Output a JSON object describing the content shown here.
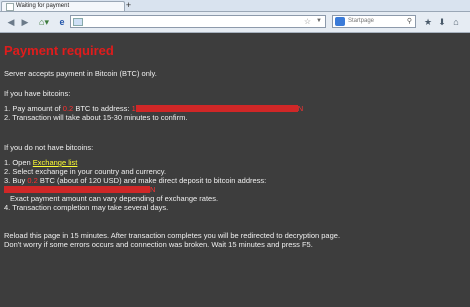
{
  "browser": {
    "tab_title": "Waiting for payment",
    "new_tab_label": "+",
    "search_placeholder": "Startpage",
    "search_icon": "magnifier-icon"
  },
  "page": {
    "heading": "Payment required",
    "intro": "Server accepts payment in Bitcoin (BTC) only.",
    "have_bitcoins": "If you have bitcoins:",
    "step1_prefix": "1. Pay amount of ",
    "step1_amount": "0.2",
    "step1_mid": " BTC to address: ",
    "step1_addr_start": "1",
    "step1_addr_end": "N",
    "step2": "2. Transaction will take about 15-30 minutes to confirm.",
    "no_bitcoins": "If you do not have bitcoins:",
    "b_step1_prefix": "1. Open ",
    "b_step1_link": "Exchange list",
    "b_step2": "2. Select exchange in your country and currency.",
    "b_step3_prefix": "3. Buy ",
    "b_step3_amount": "0.2",
    "b_step3_suffix": " BTC (about of 120 USD) and make direct deposit to bitcoin address:",
    "b_step3_addr_end": "N",
    "b_note": "Exact payment amount can vary depending of exchange rates.",
    "b_step4": "4. Transaction completion may take several days.",
    "reload1": "Reload this page in 15 minutes. After transaction completes you will be redirected to decryption page.",
    "reload2": "Don't worry if some errors occurs and connection was broken. Wait 15 minutes and press F5."
  }
}
